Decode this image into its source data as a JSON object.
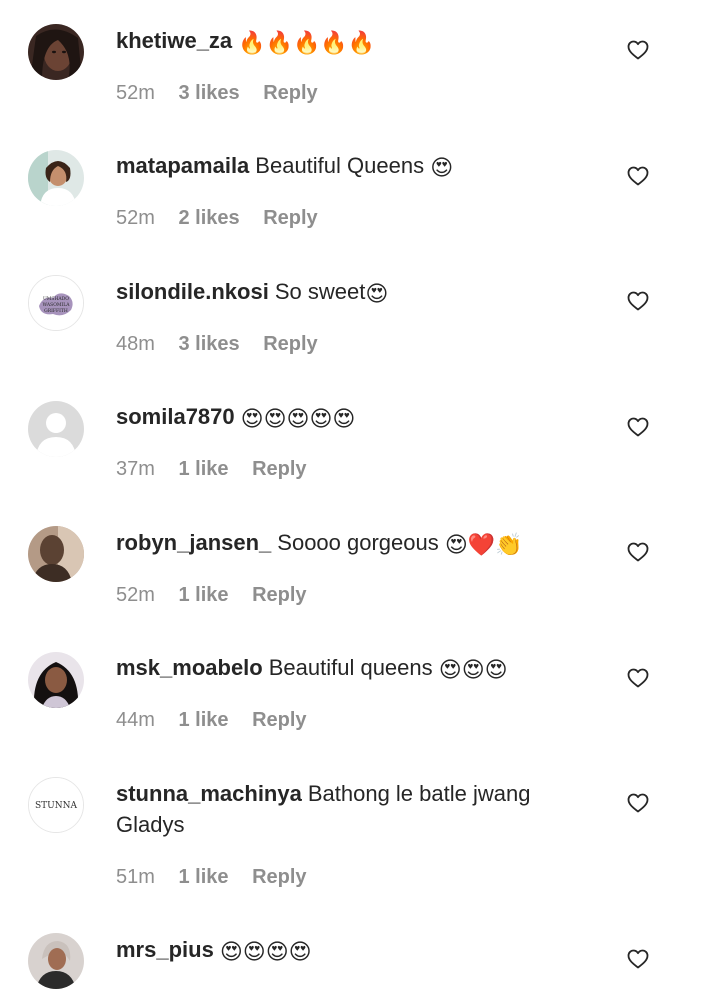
{
  "comments": [
    {
      "username": "khetiwe_za",
      "text": "",
      "emoji": "🔥🔥🔥🔥🔥",
      "time": "52m",
      "likes": "3 likes",
      "reply": "Reply"
    },
    {
      "username": "matapamaila",
      "text": "Beautiful Queens",
      "emoji": "😍",
      "time": "52m",
      "likes": "2 likes",
      "reply": "Reply"
    },
    {
      "username": "silondile.nkosi",
      "text": "So sweet",
      "emoji": "😍",
      "time": "48m",
      "likes": "3 likes",
      "reply": "Reply",
      "avatar_text": "UMSHADO WASOMILA GRIFFITH"
    },
    {
      "username": "somila7870",
      "text": "",
      "emoji": "😍😍😍😍😍",
      "time": "37m",
      "likes": "1 like",
      "reply": "Reply"
    },
    {
      "username": "robyn_jansen_",
      "text": "Soooo gorgeous",
      "emoji": "😍❤️👏",
      "time": "52m",
      "likes": "1 like",
      "reply": "Reply"
    },
    {
      "username": "msk_moabelo",
      "text": "Beautiful queens",
      "emoji": "😍😍😍",
      "time": "44m",
      "likes": "1 like",
      "reply": "Reply"
    },
    {
      "username": "stunna_machinya",
      "text": "Bathong le batle jwang Gladys",
      "emoji": "",
      "time": "51m",
      "likes": "1 like",
      "reply": "Reply",
      "avatar_text": "STUNNA"
    },
    {
      "username": "mrs_pius",
      "text": "",
      "emoji": "😍😍😍😍",
      "time": "",
      "likes": "",
      "reply": ""
    }
  ],
  "colors": {
    "text": "#262626",
    "meta": "#8e8e8e",
    "heart_outline": "#262626",
    "emoji_face": "#f7c52f",
    "emoji_heart": "#e0192b",
    "fire": "#f25a1c"
  },
  "icons": {
    "like": "heart-outline-icon",
    "default_avatar": "default-avatar-icon"
  }
}
